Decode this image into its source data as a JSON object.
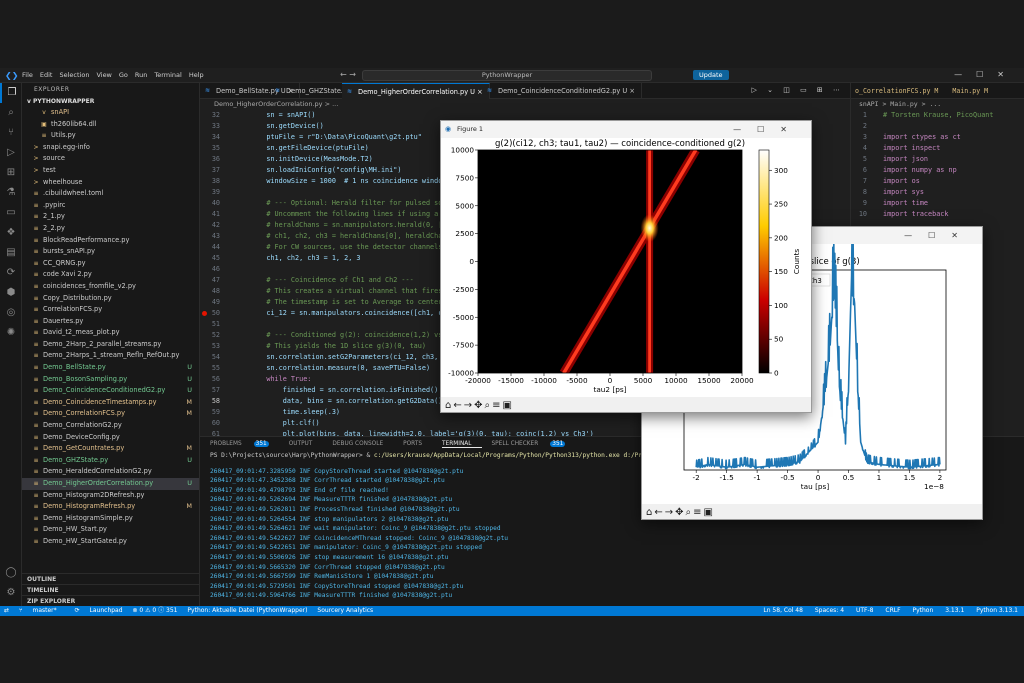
{
  "window": {
    "menu": [
      "File",
      "Edit",
      "Selection",
      "View",
      "Go",
      "Run",
      "Terminal",
      "Help"
    ],
    "command_center": "PythonWrapper",
    "update_label": "Update"
  },
  "explorer": {
    "header": "EXPLORER",
    "project": "PYTHONWRAPPER",
    "files": [
      {
        "name": "snAPI",
        "badge": "",
        "state": "mod",
        "icon": "v"
      },
      {
        "name": "th260lib64.dll",
        "badge": "",
        "state": "",
        "icon": "▣"
      },
      {
        "name": "Utils.py",
        "badge": "",
        "state": "",
        "icon": "≡"
      },
      {
        "name": "snapi.egg-info",
        "badge": "",
        "state": "",
        "icon": ">"
      },
      {
        "name": "source",
        "badge": "",
        "state": "",
        "icon": ">"
      },
      {
        "name": "test",
        "badge": "",
        "state": "",
        "icon": ">"
      },
      {
        "name": "wheelhouse",
        "badge": "",
        "state": "",
        "icon": ">"
      },
      {
        "name": ".cibuildwheel.toml",
        "badge": "",
        "state": "",
        "icon": "≡"
      },
      {
        "name": ".pypirc",
        "badge": "",
        "state": "",
        "icon": "≡"
      },
      {
        "name": "2_1.py",
        "badge": "",
        "state": "",
        "icon": "≡"
      },
      {
        "name": "2_2.py",
        "badge": "",
        "state": "",
        "icon": "≡"
      },
      {
        "name": "BlockReadPerformance.py",
        "badge": "",
        "state": "",
        "icon": "≡"
      },
      {
        "name": "bursts_snAPI.py",
        "badge": "",
        "state": "",
        "icon": "≡"
      },
      {
        "name": "CC_QRNG.py",
        "badge": "",
        "state": "",
        "icon": "≡"
      },
      {
        "name": "code Xavi 2.py",
        "badge": "",
        "state": "",
        "icon": "≡"
      },
      {
        "name": "coincidences_fromfile_v2.py",
        "badge": "",
        "state": "",
        "icon": "≡"
      },
      {
        "name": "Copy_Distribution.py",
        "badge": "",
        "state": "",
        "icon": "≡"
      },
      {
        "name": "CorrelationFCS.py",
        "badge": "",
        "state": "",
        "icon": "≡"
      },
      {
        "name": "Dauertes.py",
        "badge": "",
        "state": "",
        "icon": "≡"
      },
      {
        "name": "David_t2_meas_plot.py",
        "badge": "",
        "state": "",
        "icon": "≡"
      },
      {
        "name": "Demo_2Harp_2_parallel_streams.py",
        "badge": "",
        "state": "",
        "icon": "≡"
      },
      {
        "name": "Demo_2Harps_1_stream_Refln_RefOut.py",
        "badge": "",
        "state": "",
        "icon": "≡"
      },
      {
        "name": "Demo_BellState.py",
        "badge": "U",
        "state": "git",
        "icon": "≡"
      },
      {
        "name": "Demo_BosonSampling.py",
        "badge": "U",
        "state": "git",
        "icon": "≡"
      },
      {
        "name": "Demo_CoincidenceConditionedG2.py",
        "badge": "U",
        "state": "git",
        "icon": "≡"
      },
      {
        "name": "Demo_CoincidenceTimestamps.py",
        "badge": "M",
        "state": "mod",
        "icon": "≡"
      },
      {
        "name": "Demo_CorrelationFCS.py",
        "badge": "M",
        "state": "mod",
        "icon": "≡"
      },
      {
        "name": "Demo_CorrelationG2.py",
        "badge": "",
        "state": "",
        "icon": "≡"
      },
      {
        "name": "Demo_DeviceConfig.py",
        "badge": "",
        "state": "",
        "icon": "≡"
      },
      {
        "name": "Demo_GetCountrates.py",
        "badge": "M",
        "state": "mod",
        "icon": "≡"
      },
      {
        "name": "Demo_GHZState.py",
        "badge": "U",
        "state": "git",
        "icon": "≡"
      },
      {
        "name": "Demo_HeraldedCorrelationG2.py",
        "badge": "",
        "state": "",
        "icon": "≡"
      },
      {
        "name": "Demo_HigherOrderCorrelation.py",
        "badge": "U",
        "state": "git",
        "icon": "≡",
        "selected": true
      },
      {
        "name": "Demo_Histogram2DRefresh.py",
        "badge": "",
        "state": "",
        "icon": "≡"
      },
      {
        "name": "Demo_HistogramRefresh.py",
        "badge": "M",
        "state": "mod",
        "icon": "≡"
      },
      {
        "name": "Demo_HistogramSimple.py",
        "badge": "",
        "state": "",
        "icon": "≡"
      },
      {
        "name": "Demo_HW_Start.py",
        "badge": "",
        "state": "",
        "icon": "≡"
      },
      {
        "name": "Demo_HW_StartGated.py",
        "badge": "",
        "state": "",
        "icon": "≡"
      }
    ],
    "sections": [
      "OUTLINE",
      "TIMELINE",
      "ZIP EXPLORER"
    ]
  },
  "tabs": [
    {
      "label": "Demo_BellState.py U",
      "active": false
    },
    {
      "label": "Demo_GHZState.py U",
      "active": false
    },
    {
      "label": "Demo_HigherOrderCorrelation.py U",
      "active": true
    },
    {
      "label": "Demo_CoincidenceConditionedG2.py U",
      "active": false
    }
  ],
  "breadcrumb": "Demo_HigherOrderCorrelation.py > ...",
  "code": [
    {
      "n": "32",
      "t": "    sn = snAPI()"
    },
    {
      "n": "33",
      "t": "    sn.getDevice()"
    },
    {
      "n": "34",
      "t": "    ptuFile = r\"D:\\Data\\PicoQuant\\g2t.ptu\""
    },
    {
      "n": "35",
      "t": "    sn.getFileDevice(ptuFile)"
    },
    {
      "n": "36",
      "t": "    sn.initDevice(MeasMode.T2)"
    },
    {
      "n": "37",
      "t": "    sn.loadIniConfig(\"config\\MH.ini\")"
    },
    {
      "n": "38",
      "t": "    windowSize = 1000  # 1 ns coincidence window"
    },
    {
      "n": "39",
      "t": ""
    },
    {
      "n": "40",
      "t": "    # --- Optional: Herald filter for pulsed source"
    },
    {
      "n": "41",
      "t": "    # Uncomment the following lines if using a pul"
    },
    {
      "n": "42",
      "t": "    # heraldChans = sn.manipulators.herald(0, [1,"
    },
    {
      "n": "43",
      "t": "    # ch1, ch2, ch3 = heraldChans[0], heraldChans["
    },
    {
      "n": "44",
      "t": "    # For CW sources, use the detector channels di"
    },
    {
      "n": "45",
      "t": "    ch1, ch2, ch3 = 1, 2, 3"
    },
    {
      "n": "46",
      "t": ""
    },
    {
      "n": "47",
      "t": "    # --- Coincidence of Ch1 and Ch2 ---"
    },
    {
      "n": "48",
      "t": "    # This creates a virtual channel that fires wh"
    },
    {
      "n": "49",
      "t": "    # The timestamp is set to Average to center th"
    },
    {
      "n": "50",
      "t": "    ci_12 = sn.manipulators.coincidence([ch1, ch2"
    },
    {
      "n": "51",
      "t": ""
    },
    {
      "n": "52",
      "t": "    # --- Conditioned g(2): coincidence(1,2) vs Ch"
    },
    {
      "n": "53",
      "t": "    # This yields the 1D slice g(3)(0, tau)"
    },
    {
      "n": "54",
      "t": "    sn.correlation.setG2Parameters(ci_12, ch3, 200"
    },
    {
      "n": "55",
      "t": "    sn.correlation.measure(0, savePTU=False)"
    },
    {
      "n": "56",
      "t": "    while True:"
    },
    {
      "n": "57",
      "t": "        finished = sn.correlation.isFinished()"
    },
    {
      "n": "58",
      "t": "        data, bins = sn.correlation.getG2Data()"
    },
    {
      "n": "59",
      "t": "        time.sleep(.3)"
    },
    {
      "n": "60",
      "t": "        plt.clf()"
    },
    {
      "n": "61",
      "t": "        plt.plot(bins, data, linewidth=2.0, label='g(3)(0, tau): coinc(1,2) vs Ch3')"
    },
    {
      "n": "62",
      "t": "        plt.xlabel('tau [ps]')"
    }
  ],
  "right_editor": {
    "tabs": [
      "o_CorrelationFCS.py M",
      "Main.py M"
    ],
    "breadcrumb": "snAPI > Main.py > ...",
    "lines": [
      {
        "n": "1",
        "t": "# Torsten Krause, PicoQuant",
        "k": "cmt"
      },
      {
        "n": "2",
        "t": "",
        "k": ""
      },
      {
        "n": "3",
        "t": "import ctypes as ct",
        "k": "kw"
      },
      {
        "n": "4",
        "t": "import inspect",
        "k": "kw"
      },
      {
        "n": "5",
        "t": "import json",
        "k": "kw"
      },
      {
        "n": "6",
        "t": "import numpy as np",
        "k": "kw"
      },
      {
        "n": "7",
        "t": "import os",
        "k": "kw"
      },
      {
        "n": "8",
        "t": "import sys",
        "k": "kw"
      },
      {
        "n": "9",
        "t": "import time",
        "k": "kw"
      },
      {
        "n": "10",
        "t": "import traceback",
        "k": "kw"
      }
    ]
  },
  "panel": {
    "tabs": [
      "PROBLEMS",
      "OUTPUT",
      "DEBUG CONSOLE",
      "PORTS",
      "TERMINAL",
      "SPELL CHECKER"
    ],
    "problems_count": "351",
    "spell_count": "351",
    "command_prefix": "PS D:\\Projects\\source\\Harp\\PythonWrapper> & ",
    "command_path": "c:/Users/krause/AppData/Local/Programs/Python/Python313/python.exe d:/Pr",
    "log": [
      "260417_09:01:47.3285950 INF CopyStoreThread started @1047838@g2t.ptu",
      "260417_09:01:47.3452368 INF CorrThread started @1047838@g2t.ptu",
      "260417_09:01:49.4798793 INF End of file reached!",
      "260417_09:01:49.5262694 INF MeasureTTTR finished @1047838@g2t.ptu",
      "260417_09:01:49.5262811 INF ProcessThread finished @1047838@g2t.ptu",
      "260417_09:01:49.5264554 INF stop manipulators 2 @1047838@g2t.ptu",
      "260417_09:01:49.5264621 INF wait manipulator: Coinc_9 @1047838@g2t.ptu stopped",
      "260417_09:01:49.5422627 INF CoincidenceMThread stopped: Coinc_9 @1047838@g2t.ptu",
      "260417_09:01:49.5422651 INF manipulator: Coinc_9 @1047838@g2t.ptu stopped",
      "260417_09:01:49.5506926 INF stop measurement 16 @1047838@g2t.ptu",
      "260417_09:01:49.5665320 INF CorrThread stopped @1047838@g2t.ptu",
      "260417_09:01:49.5667599 INF RemManisStore 1 @1047838@g2t.ptu",
      "260417_09:01:49.5729501 INF CopyStoreThread stopped @1047838@g2t.ptu",
      "260417_09:01:49.5964766 INF MeasureTTTR finished @1047838@g2t.ptu"
    ]
  },
  "statusbar": {
    "branch": "master*",
    "launchpad": "Launchpad",
    "errors": "⊗ 0 ⚠ 0 ⓘ 351",
    "python_env": "Python: Aktuelle Datei (PythonWrapper)",
    "sourcery": "Sourcery Analytics",
    "position": "Ln 58, Col 48",
    "spaces": "Spaces: 4",
    "encoding": "UTF-8",
    "eol": "CRLF",
    "language": "Python",
    "version1": "3.13.1",
    "version2": "Python 3.13.1"
  },
  "figure1": {
    "window_title": "Figure 1",
    "chart_data": {
      "type": "heatmap",
      "title": "g(2)(ci12, ch3; tau1, tau2) — coincidence-conditioned g(2)",
      "xlim": [
        -20000,
        20000
      ],
      "ylim": [
        -10000,
        10000
      ],
      "xticks": [
        -20000,
        -15000,
        -10000,
        -5000,
        0,
        5000,
        10000,
        15000,
        20000
      ],
      "yticks": [
        -10000,
        -7500,
        -5000,
        -2500,
        0,
        2500,
        5000,
        7500,
        10000
      ],
      "xlabel": "tau2 [ps]",
      "colorbar_label": "Counts",
      "colorbar_range": [
        0,
        330
      ],
      "colorbar_ticks": [
        0,
        50,
        100,
        150,
        200,
        250,
        300
      ],
      "features": [
        {
          "kind": "diagonal",
          "from": [
            -7000,
            -10000
          ],
          "to": [
            13000,
            10000
          ],
          "peak": 150
        },
        {
          "kind": "vertical",
          "x": 6000,
          "peak": 130
        },
        {
          "kind": "hotspot",
          "x": 6000,
          "y": 3000,
          "peak": 320
        }
      ]
    }
  },
  "figure2": {
    "window_title": "",
    "chart_data": {
      "type": "line",
      "title": "2) — slice of g(3)",
      "legend": "Ch3",
      "xlabel": "tau [ps]",
      "x_scale_label": "1e−8",
      "xlim": [
        -2.2,
        2.1
      ],
      "xticks": [
        -2.0,
        -1.5,
        -1.0,
        -0.5,
        0.0,
        0.5,
        1.0,
        1.5,
        2.0
      ],
      "series": [
        {
          "x": [
            -2.0,
            -1.8,
            -1.5,
            -1.2,
            -1.0,
            -0.5,
            -0.3,
            0.0,
            0.1,
            0.2,
            0.25,
            0.3,
            0.35,
            0.4,
            0.45,
            0.5,
            0.55,
            0.6,
            0.65,
            0.7,
            0.8,
            1.0,
            1.5,
            2.0
          ],
          "y": [
            1,
            2,
            1,
            2,
            1,
            2,
            3,
            10,
            25,
            45,
            65,
            55,
            30,
            20,
            10,
            30,
            70,
            60,
            30,
            10,
            3,
            2,
            1,
            2
          ]
        }
      ]
    }
  }
}
